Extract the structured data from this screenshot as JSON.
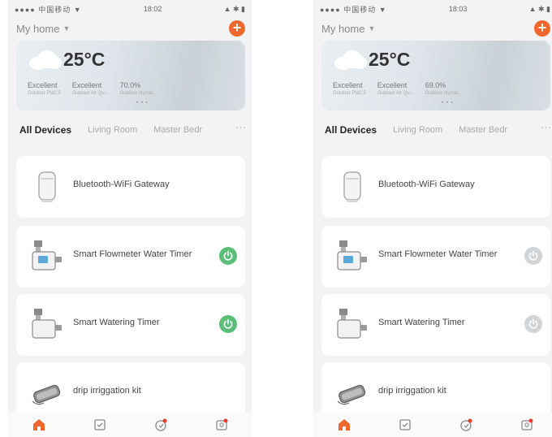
{
  "colors": {
    "accent": "#f0672e",
    "power_on": "#5bbf7a",
    "power_off": "#d2d4d6",
    "badge": "#e8402a"
  },
  "phones": [
    {
      "status": {
        "carrier": "●●●● 中国移动 ▼",
        "time": "18:02",
        "battery": "▲ ✱ ▮"
      },
      "home_label": "My home",
      "weather": {
        "temp": "25°C",
        "stats": [
          {
            "value": "Excellent",
            "label": "Outdoor PM2.5"
          },
          {
            "value": "Excellent",
            "label": "Outdoor Air Qu..."
          },
          {
            "value": "70.0%",
            "label": "Outdoor Humid..."
          }
        ]
      },
      "tabs": [
        "All Devices",
        "Living Room",
        "Master Bedr"
      ],
      "devices": [
        {
          "name": "Bluetooth-WiFi Gateway",
          "icon": "gateway-icon",
          "power": null
        },
        {
          "name": "Smart Flowmeter Water Timer",
          "icon": "flowmeter-timer-icon",
          "power": "on"
        },
        {
          "name": "Smart Watering Timer",
          "icon": "watering-timer-icon",
          "power": "on"
        },
        {
          "name": "drip irriggation kit",
          "icon": "drip-kit-icon",
          "power": null
        }
      ]
    },
    {
      "status": {
        "carrier": "●●●● 中国移动 ▼",
        "time": "18:03",
        "battery": "▲ ✱ ▮"
      },
      "home_label": "My home",
      "weather": {
        "temp": "25°C",
        "stats": [
          {
            "value": "Excellent",
            "label": "Outdoor PM2.5"
          },
          {
            "value": "Excellent",
            "label": "Outdoor Air Qu..."
          },
          {
            "value": "69.0%",
            "label": "Outdoor Humid..."
          }
        ]
      },
      "tabs": [
        "All Devices",
        "Living Room",
        "Master Bedr"
      ],
      "devices": [
        {
          "name": "Bluetooth-WiFi Gateway",
          "icon": "gateway-icon",
          "power": null
        },
        {
          "name": "Smart Flowmeter Water Timer",
          "icon": "flowmeter-timer-icon",
          "power": "off"
        },
        {
          "name": "Smart Watering Timer",
          "icon": "watering-timer-icon",
          "power": "off"
        },
        {
          "name": "drip irriggation kit",
          "icon": "drip-kit-icon",
          "power": null
        }
      ]
    }
  ]
}
